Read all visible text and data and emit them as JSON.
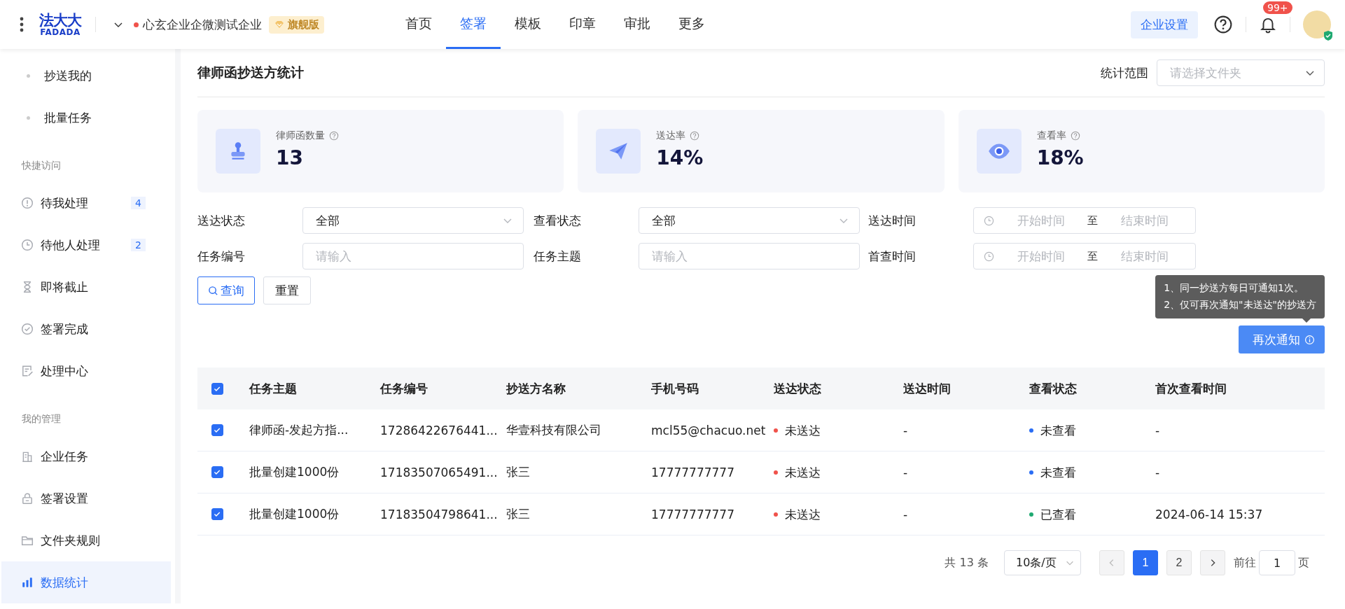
{
  "topbar": {
    "logo": {
      "cn": "法大大",
      "en": "FADADA"
    },
    "company": "心玄企业企微测试企业",
    "edition": "旗舰版",
    "nav": [
      {
        "label": "首页",
        "selected": false
      },
      {
        "label": "签署",
        "selected": true
      },
      {
        "label": "模板",
        "selected": false
      },
      {
        "label": "印章",
        "selected": false
      },
      {
        "label": "审批",
        "selected": false
      },
      {
        "label": "更多",
        "selected": false
      }
    ],
    "settings_button": "企业设置",
    "notification_badge": "99+"
  },
  "sidebar": {
    "sub_items": [
      {
        "label": "抄送我的",
        "selected": false
      },
      {
        "label": "批量任务",
        "selected": false
      }
    ],
    "sections": [
      {
        "heading": "快捷访问",
        "items": [
          {
            "label": "待我处理",
            "badge": "4",
            "selected": false
          },
          {
            "label": "待他人处理",
            "badge": "2",
            "selected": false
          },
          {
            "label": "即将截止",
            "selected": false
          },
          {
            "label": "签署完成",
            "selected": false
          },
          {
            "label": "处理中心",
            "selected": false
          }
        ]
      },
      {
        "heading": "我的管理",
        "items": [
          {
            "label": "企业任务",
            "selected": false
          },
          {
            "label": "签署设置",
            "selected": false
          },
          {
            "label": "文件夹规则",
            "selected": false
          },
          {
            "label": "数据统计",
            "selected": true
          }
        ]
      }
    ]
  },
  "page": {
    "title": "律师函抄送方统计",
    "scope_label": "统计范围",
    "scope_placeholder": "请选择文件夹"
  },
  "stats": [
    {
      "label": "律师函数量",
      "value": "13"
    },
    {
      "label": "送达率",
      "value": "14%"
    },
    {
      "label": "查看率",
      "value": "18%"
    }
  ],
  "filters": [
    {
      "kind": "select",
      "label": "送达状态",
      "value": "全部"
    },
    {
      "kind": "select",
      "label": "查看状态",
      "value": "全部"
    },
    {
      "kind": "daterange",
      "label": "送达时间",
      "start_placeholder": "开始时间",
      "separator": "至",
      "end_placeholder": "结束时间"
    },
    {
      "kind": "input",
      "label": "任务编号",
      "placeholder": "请输入"
    },
    {
      "kind": "input",
      "label": "任务主题",
      "placeholder": "请输入"
    },
    {
      "kind": "daterange",
      "label": "首查时间",
      "start_placeholder": "开始时间",
      "separator": "至",
      "end_placeholder": "结束时间"
    }
  ],
  "buttons": {
    "search": "查询",
    "reset": "重置",
    "renotify": "再次通知"
  },
  "tooltip": [
    "1、同一抄送方每日可通知1次。",
    "2、仅可再次通知\"未送达\"的抄送方"
  ],
  "table": {
    "select_all": true,
    "columns": [
      "任务主题",
      "任务编号",
      "抄送方名称",
      "手机号码",
      "送达状态",
      "送达时间",
      "查看状态",
      "首次查看时间"
    ],
    "rows": [
      {
        "selected": true,
        "subject": "律师函-发起方指...",
        "task_no": "17286422676441...",
        "recipient": "华壹科技有限公司",
        "phone": "mcl55@chacuo.net",
        "delivery": {
          "text": "未送达",
          "color": "#f0524b"
        },
        "delivery_time": "-",
        "view": {
          "text": "未查看",
          "color": "#2a6df4"
        },
        "first_view": "-"
      },
      {
        "selected": true,
        "subject": "批量创建1000份",
        "task_no": "17183507065491...",
        "recipient": "张三",
        "phone": "17777777777",
        "delivery": {
          "text": "未送达",
          "color": "#f0524b"
        },
        "delivery_time": "-",
        "view": {
          "text": "未查看",
          "color": "#2a6df4"
        },
        "first_view": "-"
      },
      {
        "selected": true,
        "subject": "批量创建1000份",
        "task_no": "17183504798641...",
        "recipient": "张三",
        "phone": "17777777777",
        "delivery": {
          "text": "未送达",
          "color": "#f0524b"
        },
        "delivery_time": "-",
        "view": {
          "text": "已查看",
          "color": "#1fa971"
        },
        "first_view": "2024-06-14 15:37"
      }
    ]
  },
  "pagination": {
    "total": "共 13 条",
    "page_size": "10条/页",
    "prev_disabled": true,
    "next_disabled": false,
    "pages": [
      {
        "label": "1",
        "selected": true
      },
      {
        "label": "2",
        "selected": false
      }
    ],
    "goto_label": "前往",
    "goto_value": "1",
    "goto_suffix": "页"
  }
}
